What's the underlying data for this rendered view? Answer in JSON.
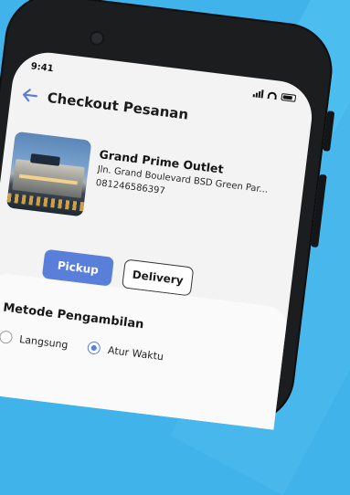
{
  "status_bar": {
    "time": "9:41"
  },
  "header": {
    "title": "Checkout Pesanan"
  },
  "store": {
    "name": "Grand Prime Outlet",
    "address": "Jln. Grand Boulevard BSD Green Par...",
    "phone": "081246586397"
  },
  "tabs": [
    {
      "label": "Pickup",
      "active": true
    },
    {
      "label": "Delivery",
      "active": false
    }
  ],
  "pickup_method": {
    "title": "Metode Pengambilan",
    "options": [
      {
        "label": "Langsung",
        "selected": false
      },
      {
        "label": "Atur Waktu",
        "selected": true
      }
    ]
  },
  "colors": {
    "accent": "#5a7fdb",
    "background": "#3fb3ea"
  }
}
